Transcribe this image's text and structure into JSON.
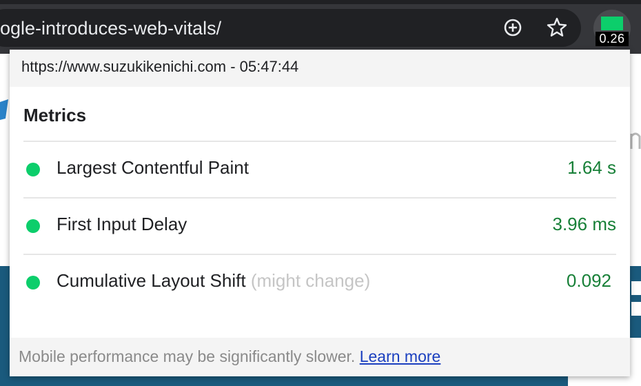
{
  "browser": {
    "url_text": "ogle-introduces-web-vitals/",
    "add_icon": "add-circle-icon",
    "bookmark_icon": "star-icon",
    "extension": {
      "badge": "0.26",
      "indicator_color": "#0cce6b"
    }
  },
  "popup": {
    "header": "https://www.suzukikenichi.com - 05:47:44",
    "section_title": "Metrics",
    "metrics": [
      {
        "name": "Largest Contentful Paint",
        "note": "",
        "value": "1.64 s",
        "status_color": "#0cce6b"
      },
      {
        "name": "First Input Delay",
        "note": "",
        "value": "3.96 ms",
        "status_color": "#0cce6b"
      },
      {
        "name": "Cumulative Layout Shift",
        "note": "(might change)",
        "value": "0.092",
        "status_color": "#0cce6b"
      }
    ],
    "footer": {
      "text": "Mobile performance may be significantly slower.",
      "link": "Learn more"
    }
  },
  "colors": {
    "good": "#0cce6b",
    "value_text": "#188038",
    "link": "#1a3fbf"
  }
}
